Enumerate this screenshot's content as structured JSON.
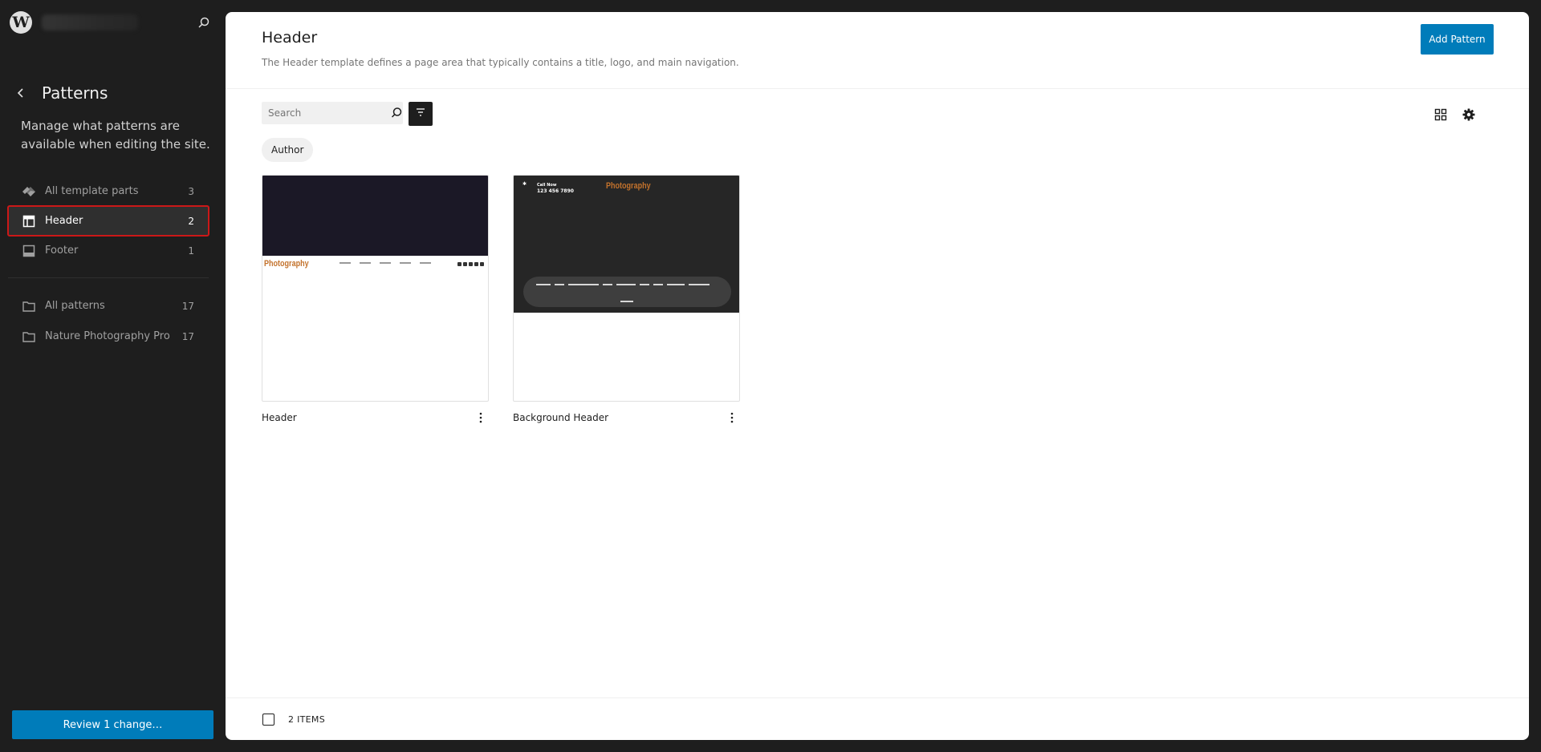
{
  "sidebar": {
    "title": "Patterns",
    "description": "Manage what patterns are available when editing the site.",
    "template_parts": [
      {
        "label": "All template parts",
        "count": "3",
        "icon": "diamond-icon"
      },
      {
        "label": "Header",
        "count": "2",
        "icon": "header-layout-icon",
        "active": true
      },
      {
        "label": "Footer",
        "count": "1",
        "icon": "footer-layout-icon"
      }
    ],
    "categories": [
      {
        "label": "All patterns",
        "count": "17",
        "icon": "folder-icon"
      },
      {
        "label": "Nature Photography Pro",
        "count": "17",
        "icon": "folder-icon"
      }
    ],
    "review_label": "Review 1 change…"
  },
  "main": {
    "title": "Header",
    "description": "The Header template defines a page area that typically contains a title, logo, and main navigation.",
    "add_label": "Add Pattern",
    "search": {
      "placeholder": "Search",
      "value": ""
    },
    "filter_chip": "Author",
    "cards": [
      {
        "title": "Header",
        "preview_brand": "Photography"
      },
      {
        "title": "Background Header",
        "preview_brand": "Photography",
        "preview_call": "Call Now",
        "preview_phone": "123 456 7890"
      }
    ],
    "footer": {
      "items_count": "2 ITEMS"
    }
  },
  "colors": {
    "accent": "#007cba",
    "sidebar_bg": "#1e1e1e",
    "highlight_outline": "#cc1818",
    "preview_brand": "#c3722c"
  }
}
